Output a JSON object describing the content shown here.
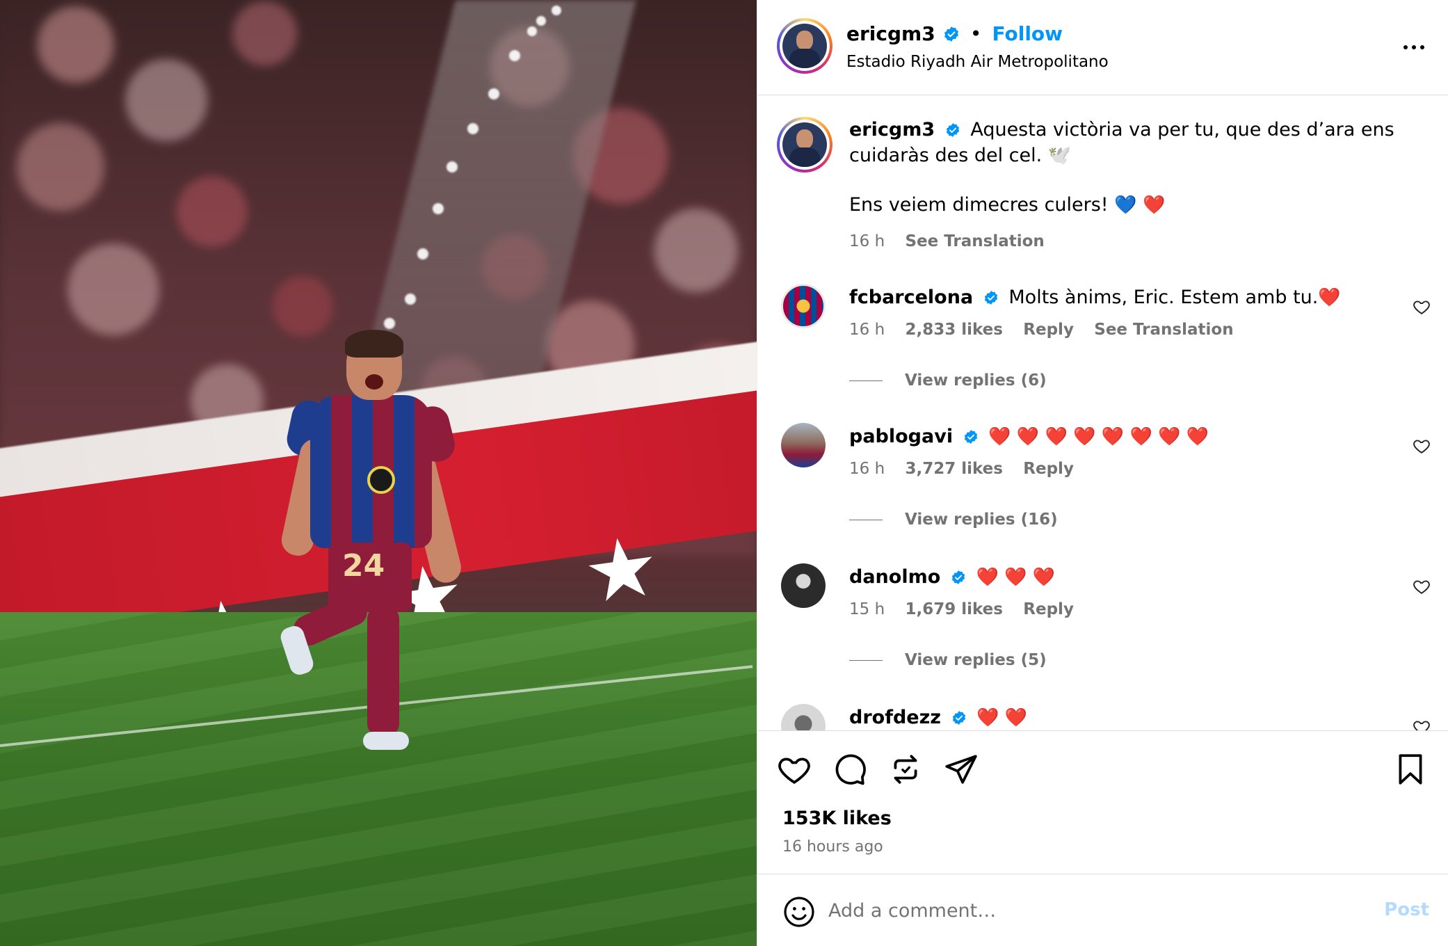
{
  "header": {
    "username": "ericgm3",
    "follow_label": "Follow",
    "separator": "•",
    "location": "Estadio Riyadh Air Metropolitano"
  },
  "photo": {
    "jersey_number": "24"
  },
  "caption": {
    "username": "ericgm3",
    "line1": "Aquesta victòria va per tu, que des d’ara ens cuidaràs des del cel. 🕊️",
    "line2": "Ens veiem dimecres culers!",
    "time": "16 h",
    "see_translation": "See Translation"
  },
  "comments": [
    {
      "username": "fcbarcelona",
      "text": "Molts ànims, Eric. Estem amb tu.",
      "hearts": "❤️",
      "time": "16 h",
      "likes": "2,833 likes",
      "reply": "Reply",
      "see_translation": "See Translation",
      "view_replies": "View replies (6)"
    },
    {
      "username": "pablogavi",
      "text": "",
      "hearts": "❤️ ❤️ ❤️ ❤️ ❤️ ❤️ ❤️ ❤️",
      "time": "16 h",
      "likes": "3,727 likes",
      "reply": "Reply",
      "view_replies": "View replies (16)"
    },
    {
      "username": "danolmo",
      "text": "",
      "hearts": "❤️ ❤️ ❤️",
      "time": "15 h",
      "likes": "1,679 likes",
      "reply": "Reply",
      "view_replies": "View replies (5)"
    },
    {
      "username": "drofdezz",
      "text": "",
      "hearts": "❤️ ❤️"
    }
  ],
  "actions": {
    "likes": "153K likes",
    "time_ago": "16 hours ago"
  },
  "comment_bar": {
    "placeholder": "Add a comment…",
    "post_label": "Post"
  },
  "colors": {
    "link_blue": "#0095f6",
    "muted": "#737373",
    "post_disabled": "#b3dbff",
    "verified_blue": "#0095f6",
    "heart_red": "#f02849"
  }
}
